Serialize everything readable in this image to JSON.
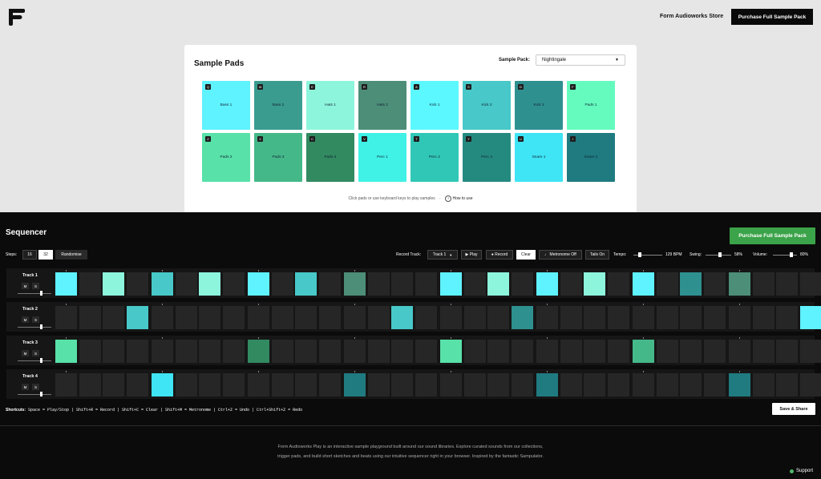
{
  "header": {
    "store_link": "Form Audioworks Store",
    "purchase_button": "Purchase Full Sample Pack"
  },
  "sample_pads": {
    "title": "Sample Pads",
    "pack_label": "Sample Pack:",
    "pack_value": "Nightingale",
    "hint": "Click pads or use keyboard keys to play samples",
    "how_to_use": "How to use",
    "pads": [
      {
        "key": "Q",
        "label": "Bass 1",
        "color": "#5ff2ff"
      },
      {
        "key": "W",
        "label": "Bass 2",
        "color": "#3a9c8f"
      },
      {
        "key": "E",
        "label": "Hats 1",
        "color": "#8ef5dd"
      },
      {
        "key": "R",
        "label": "Hats 2",
        "color": "#4d8e78"
      },
      {
        "key": "A",
        "label": "Kick 1",
        "color": "#5cf8ff"
      },
      {
        "key": "S",
        "label": "Kick 2",
        "color": "#48c8c8"
      },
      {
        "key": "D",
        "label": "Kick 3",
        "color": "#2f9090"
      },
      {
        "key": "F",
        "label": "Pads 1",
        "color": "#65fbbf"
      },
      {
        "key": "Z",
        "label": "Pads 2",
        "color": "#58e1a8"
      },
      {
        "key": "X",
        "label": "Pads 3",
        "color": "#45b88a"
      },
      {
        "key": "C",
        "label": "Pads 4",
        "color": "#328a61"
      },
      {
        "key": "V",
        "label": "Perc 1",
        "color": "#40f2e6"
      },
      {
        "key": "T",
        "label": "Perc 2",
        "color": "#30c7b6"
      },
      {
        "key": "Y",
        "label": "Perc 3",
        "color": "#248a80"
      },
      {
        "key": "U",
        "label": "Snare 1",
        "color": "#3fe4f5"
      },
      {
        "key": "I",
        "label": "Snare 2",
        "color": "#1f7b80"
      }
    ]
  },
  "sequencer": {
    "title": "Sequencer",
    "purchase_button": "Purchase Full Sample Pack",
    "steps_label": "Steps:",
    "steps_options": [
      "16",
      "32"
    ],
    "steps_selected": "32",
    "randomise": "Randomise",
    "record_track_label": "Record Track:",
    "record_track_value": "Track 1",
    "play": "▶ Play",
    "record": "● Record",
    "clear": "Clear",
    "metronome": "♩ Metronome Off",
    "tails": "Tails On",
    "tempo_label": "Tempo:",
    "tempo_value": "129 BPM",
    "tempo_level": 0.2,
    "swing_label": "Swing:",
    "swing_value": "58%",
    "swing_level": 0.58,
    "volume_label": "Volume:",
    "volume_value": "80%",
    "volume_level": 0.8,
    "mute": "M",
    "solo": "S",
    "tracks": [
      {
        "name": "Track 1",
        "active": [
          {
            "step": 0,
            "color": "#5ff2ff"
          },
          {
            "step": 2,
            "color": "#8ef5dd"
          },
          {
            "step": 4,
            "color": "#48c8c8"
          },
          {
            "step": 6,
            "color": "#8ef5dd"
          },
          {
            "step": 8,
            "color": "#5ff2ff"
          },
          {
            "step": 10,
            "color": "#48c8c8"
          },
          {
            "step": 12,
            "color": "#4d8e78"
          },
          {
            "step": 16,
            "color": "#5ff2ff"
          },
          {
            "step": 18,
            "color": "#8ef5dd"
          },
          {
            "step": 20,
            "color": "#5ff2ff"
          },
          {
            "step": 22,
            "color": "#8ef5dd"
          },
          {
            "step": 24,
            "color": "#5ff2ff"
          },
          {
            "step": 26,
            "color": "#2f9090"
          },
          {
            "step": 28,
            "color": "#4d8e78"
          }
        ]
      },
      {
        "name": "Track 2",
        "active": [
          {
            "step": 3,
            "color": "#48c8c8"
          },
          {
            "step": 14,
            "color": "#48c8c8"
          },
          {
            "step": 19,
            "color": "#2f9090"
          },
          {
            "step": 31,
            "color": "#5ff2ff"
          }
        ]
      },
      {
        "name": "Track 3",
        "active": [
          {
            "step": 0,
            "color": "#58e1a8"
          },
          {
            "step": 8,
            "color": "#328a61"
          },
          {
            "step": 16,
            "color": "#58e1a8"
          },
          {
            "step": 24,
            "color": "#45b88a"
          }
        ]
      },
      {
        "name": "Track 4",
        "active": [
          {
            "step": 4,
            "color": "#3fe4f5"
          },
          {
            "step": 12,
            "color": "#1f7b80"
          },
          {
            "step": 20,
            "color": "#1f7b80"
          },
          {
            "step": 28,
            "color": "#1f7b80"
          }
        ]
      }
    ],
    "shortcuts_label": "Shortcuts:",
    "shortcuts_text": "Space = Play/Stop | Shift+R = Record | Shift+C = Clear | Shift+M = Metronome | Ctrl+Z = Undo | Ctrl+Shift+Z = Redo",
    "save_share": "Save & Share"
  },
  "footer": {
    "text": "Form Audioworks Play is an interactive sample playground built around our sound libraries. Explore curated sounds from our collections, trigger pads, and build short sketches and beats using our intuitive sequencer right in your browser. Inspired by the fantastic Sampulator.",
    "support": "Support"
  }
}
